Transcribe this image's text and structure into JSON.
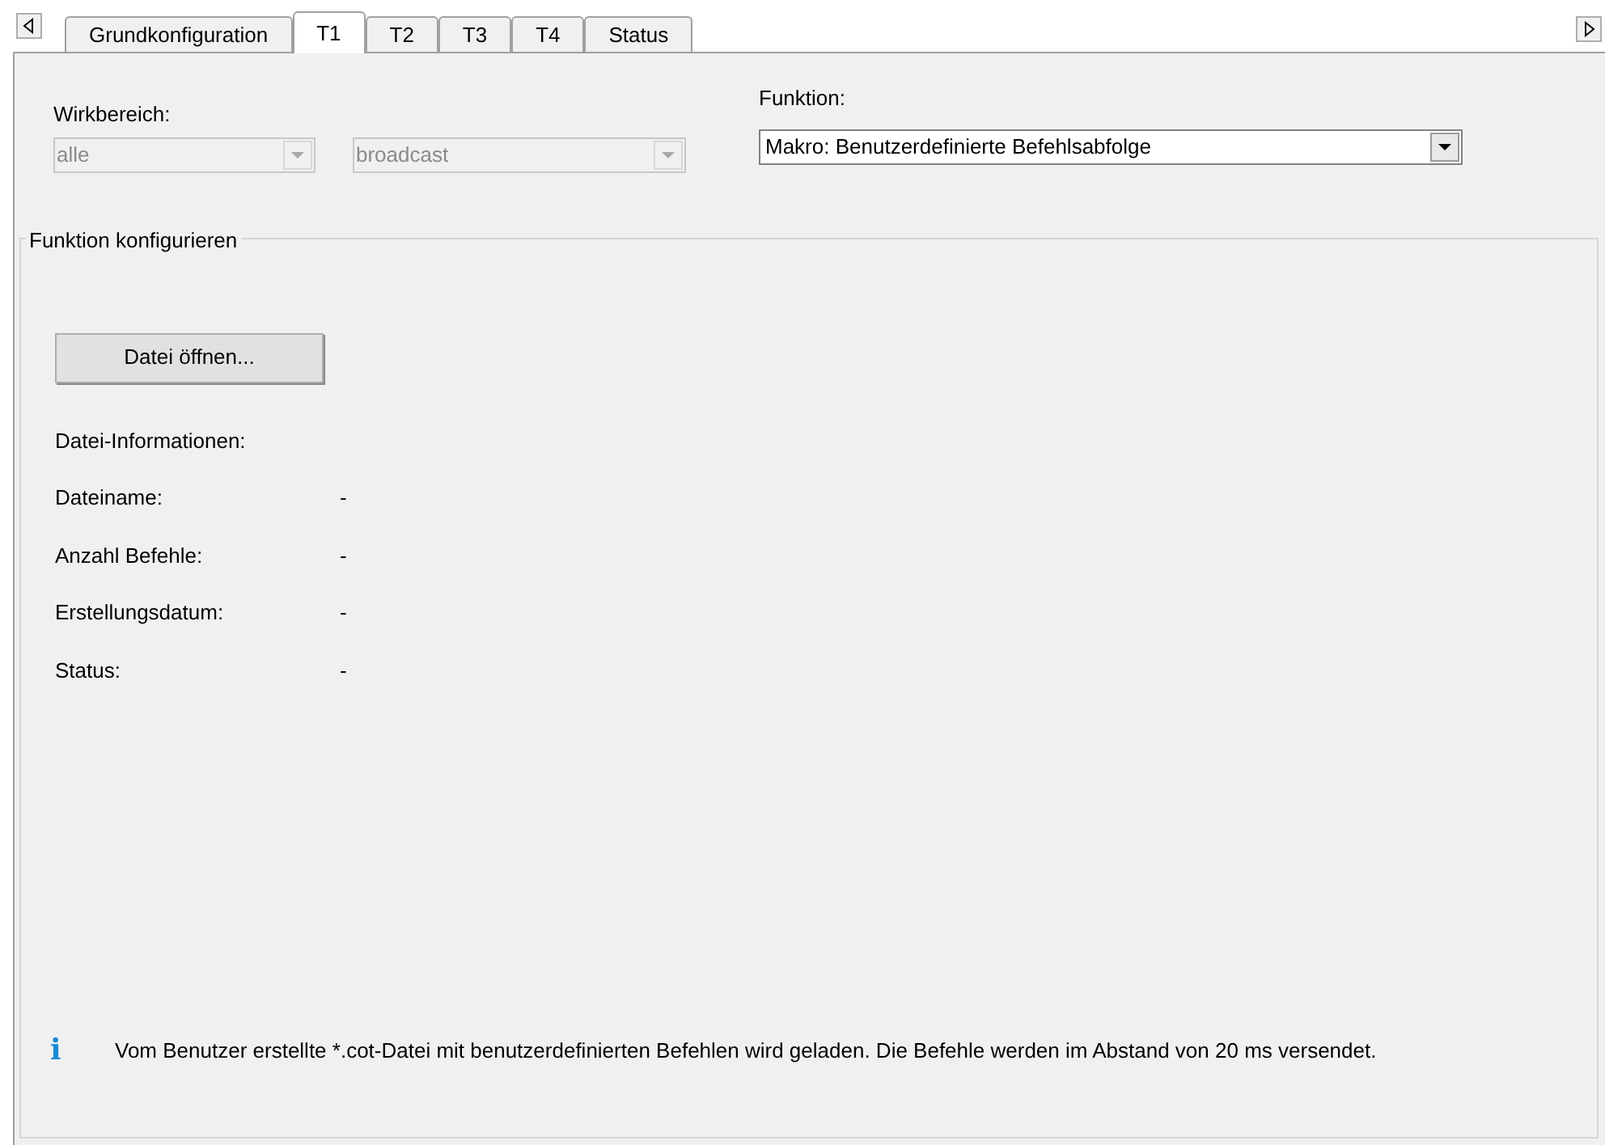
{
  "tabs": [
    {
      "label": "Grundkonfiguration",
      "selected": false
    },
    {
      "label": "T1",
      "selected": true
    },
    {
      "label": "T2",
      "selected": false
    },
    {
      "label": "T3",
      "selected": false
    },
    {
      "label": "T4",
      "selected": false
    },
    {
      "label": "Status",
      "selected": false
    }
  ],
  "scope": {
    "label": "Wirkbereich:",
    "dropdowns": [
      {
        "value": "alle",
        "disabled": true
      },
      {
        "value": "broadcast",
        "disabled": true
      }
    ]
  },
  "function": {
    "label": "Funktion:",
    "dropdown": {
      "value": "Makro: Benutzerdefinierte Befehlsabfolge",
      "disabled": false
    }
  },
  "group": {
    "title": "Funktion konfigurieren",
    "button": "Datei öffnen...",
    "info_heading": "Datei-Informationen:",
    "fields": [
      {
        "label": "Dateiname:",
        "value": "-"
      },
      {
        "label": "Anzahl Befehle:",
        "value": "-"
      },
      {
        "label": "Erstellungsdatum:",
        "value": "-"
      },
      {
        "label": "Status:",
        "value": "-"
      }
    ],
    "info_icon": "i",
    "note": "Vom Benutzer erstellte *.cot-Datei mit benutzerdefinierten Befehlen wird geladen. Die Befehle werden im Abstand von 20 ms versendet."
  }
}
